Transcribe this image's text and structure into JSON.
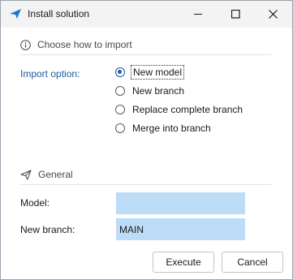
{
  "window": {
    "title": "Install solution",
    "icons": {
      "app": "send-arrow-icon",
      "minimize": "minimize-icon",
      "maximize": "maximize-icon",
      "close": "close-icon"
    }
  },
  "section_import": {
    "title": "Choose how to import",
    "icon": "info-icon"
  },
  "import_option": {
    "label": "Import option:",
    "options": [
      {
        "label": "New model",
        "selected": true
      },
      {
        "label": "New branch",
        "selected": false
      },
      {
        "label": "Replace complete branch",
        "selected": false
      },
      {
        "label": "Merge into branch",
        "selected": false
      }
    ]
  },
  "section_general": {
    "title": "General",
    "icon": "paper-plane-icon"
  },
  "fields": {
    "model_label": "Model:",
    "model_value": "",
    "branch_label": "New branch:",
    "branch_value": "MAIN"
  },
  "buttons": {
    "execute": "Execute",
    "cancel": "Cancel"
  },
  "colors": {
    "accent": "#1f5c99",
    "input_bg": "#bcdcf7",
    "titlebar_bg": "#f3f3f3"
  }
}
